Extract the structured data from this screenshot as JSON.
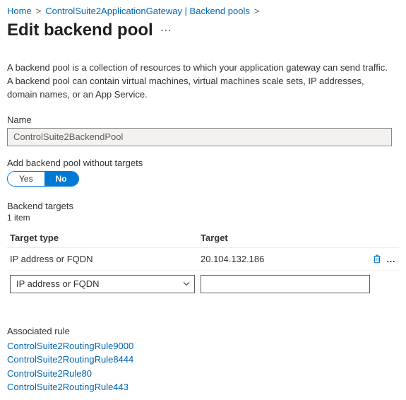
{
  "breadcrumb": {
    "home": "Home",
    "parent": "ControlSuite2ApplicationGateway | Backend pools"
  },
  "title": "Edit backend pool",
  "description": "A backend pool is a collection of resources to which your application gateway can send traffic. A backend pool can contain virtual machines, virtual machines scale sets, IP addresses, domain names, or an App Service.",
  "name_label": "Name",
  "name_value": "ControlSuite2BackendPool",
  "without_targets_label": "Add backend pool without targets",
  "toggle": {
    "yes": "Yes",
    "no": "No"
  },
  "targets": {
    "heading": "Backend targets",
    "count": "1 item",
    "col_type": "Target type",
    "col_target": "Target",
    "rows": [
      {
        "type": "IP address or FQDN",
        "target": "20.104.132.186"
      }
    ],
    "new_select": "IP address or FQDN"
  },
  "associated": {
    "heading": "Associated rule",
    "rules": [
      "ControlSuite2RoutingRule9000",
      "ControlSuite2RoutingRule8444",
      "ControlSuite2Rule80",
      "ControlSuite2RoutingRule443"
    ]
  }
}
